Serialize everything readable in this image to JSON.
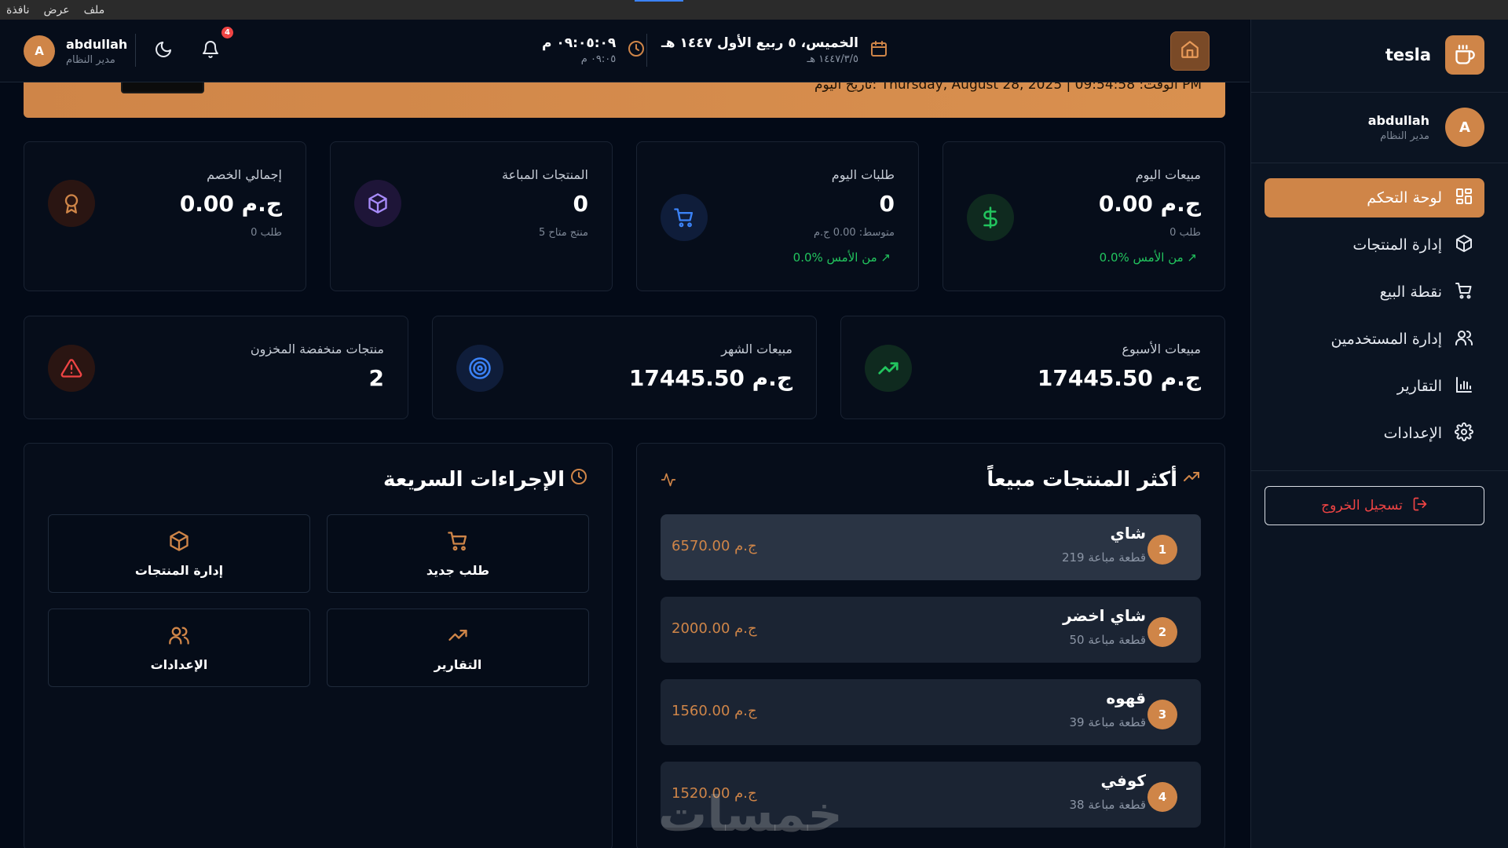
{
  "menubar": {
    "items": [
      "ملف",
      "عرض",
      "نافذة"
    ]
  },
  "sidebar": {
    "brand_name": "tesla",
    "user": {
      "initial": "A",
      "name": "abdullah",
      "role": "مدير النظام"
    },
    "items": [
      {
        "label": "لوحة التحكم",
        "icon": "dashboard-icon",
        "active": true
      },
      {
        "label": "إدارة المنتجات",
        "icon": "box-icon"
      },
      {
        "label": "نقطة البيع",
        "icon": "cart-icon"
      },
      {
        "label": "إدارة المستخدمين",
        "icon": "users-icon"
      },
      {
        "label": "التقارير",
        "icon": "bar-chart-icon"
      },
      {
        "label": "الإعدادات",
        "icon": "gear-icon"
      }
    ],
    "logout_label": "تسجيل الخروج"
  },
  "header": {
    "user": {
      "initial": "A",
      "name": "abdullah",
      "role": "مدير النظام"
    },
    "notification_count": "4",
    "time_main": "٠٩:٠٥:٠٩ م",
    "time_sub": "٠٩:٠٥ م",
    "date_main": "الخميس، ٥ ربيع الأول ١٤٤٧ هـ",
    "date_sub": "١٤٤٧/٣/٥ هـ"
  },
  "banner": {
    "text": "تاريخ اليوم: Thursday, August 28, 2025 | الوقت: 09:54:58 PM"
  },
  "stats_row1": [
    {
      "label": "مبيعات اليوم",
      "value": "0.00 ج.م",
      "sub": "0 طلب",
      "trend": "0.0% من الأمس",
      "icon": "dollar-icon"
    },
    {
      "label": "طلبات اليوم",
      "value": "0",
      "sub": "متوسط: 0.00 ج.م",
      "trend": "0.0% من الأمس",
      "icon": "cart-icon"
    },
    {
      "label": "المنتجات المباعة",
      "value": "0",
      "sub": "5 منتج متاح",
      "icon": "box-icon"
    },
    {
      "label": "إجمالي الخصم",
      "value": "0.00 ج.م",
      "sub": "0 طلب",
      "icon": "award-icon"
    }
  ],
  "stats_row2": [
    {
      "label": "مبيعات الأسبوع",
      "value": "17445.50 ج.م",
      "icon": "trending-up-icon"
    },
    {
      "label": "مبيعات الشهر",
      "value": "17445.50 ج.م",
      "icon": "target-icon"
    },
    {
      "label": "منتجات منخفضة المخزون",
      "value": "2",
      "icon": "warning-icon"
    }
  ],
  "top_products": {
    "title": "أكثر المنتجات مبيعاً",
    "items": [
      {
        "rank": "1",
        "name": "شاي",
        "qty": "219 قطعة مباعة",
        "price": "6570.00 ج.م"
      },
      {
        "rank": "2",
        "name": "شاي اخضر",
        "qty": "50 قطعة مباعة",
        "price": "2000.00 ج.م"
      },
      {
        "rank": "3",
        "name": "قهوه",
        "qty": "39 قطعة مباعة",
        "price": "1560.00 ج.م"
      },
      {
        "rank": "4",
        "name": "كوفي",
        "qty": "38 قطعة مباعة",
        "price": "1520.00 ج.م"
      }
    ]
  },
  "quick_actions": {
    "title": "الإجراءات السريعة",
    "items": [
      {
        "label": "طلب جديد",
        "icon": "cart-icon"
      },
      {
        "label": "إدارة المنتجات",
        "icon": "box-icon"
      },
      {
        "label": "التقارير",
        "icon": "trending-up-icon"
      },
      {
        "label": "الإعدادات",
        "icon": "users-icon"
      }
    ]
  },
  "watermark": "خمسات",
  "colors": {
    "accent": "#cf8548",
    "background": "#030a17",
    "card": "#060d1a",
    "success": "#22c55e",
    "danger": "#ef4444"
  }
}
